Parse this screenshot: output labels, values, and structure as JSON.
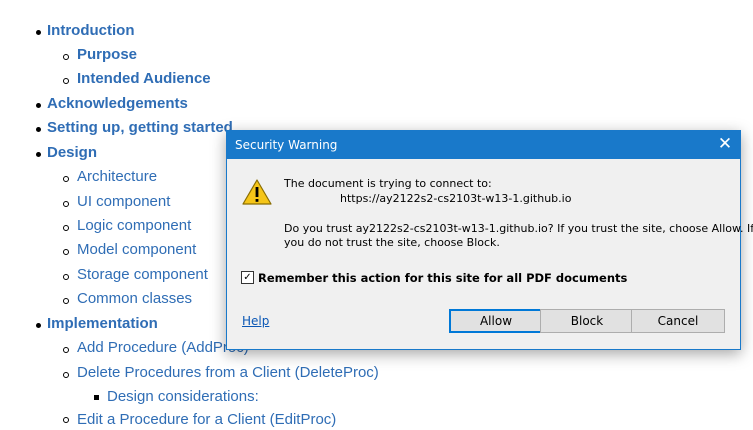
{
  "toc": {
    "items": [
      {
        "label": "Introduction",
        "level": 1
      },
      {
        "label": "Purpose",
        "level": 2
      },
      {
        "label": "Intended Audience",
        "level": 2
      },
      {
        "label": "Acknowledgements",
        "level": 1
      },
      {
        "label": "Setting up, getting started",
        "level": 1
      },
      {
        "label": "Design",
        "level": 1
      },
      {
        "label": "Architecture",
        "level": 2
      },
      {
        "label": "UI component",
        "level": 2
      },
      {
        "label": "Logic component",
        "level": 2
      },
      {
        "label": "Model component",
        "level": 2
      },
      {
        "label": "Storage component",
        "level": 2
      },
      {
        "label": "Common classes",
        "level": 2
      },
      {
        "label": "Implementation",
        "level": 1
      },
      {
        "label": "Add Procedure (AddProc)",
        "level": 2
      },
      {
        "label": "Delete Procedures from a Client (DeleteProc)",
        "level": 2
      },
      {
        "label": "Design considerations:",
        "level": 3
      },
      {
        "label": "Edit a Procedure for a Client (EditProc)",
        "level": 2
      }
    ]
  },
  "dialog": {
    "title": "Security Warning",
    "close_glyph": "✕",
    "message_line1": "The document is trying to connect to:",
    "url": "https://ay2122s2-cs2103t-w13-1.github.io",
    "question_line1": "Do you trust ay2122s2-cs2103t-w13-1.github.io? If you trust the site, choose Allow. If",
    "question_line2": "you do not trust the site, choose Block.",
    "checkbox_checked": true,
    "checkbox_mark": "✓",
    "checkbox_label": "Remember this action for this site for all PDF documents",
    "help_label": "Help",
    "buttons": {
      "allow": "Allow",
      "block": "Block",
      "cancel": "Cancel"
    },
    "icon": "warning-icon",
    "colors": {
      "titlebar": "#1979ca",
      "link": "#2f6db5",
      "warning_fill": "#f5c518"
    }
  }
}
